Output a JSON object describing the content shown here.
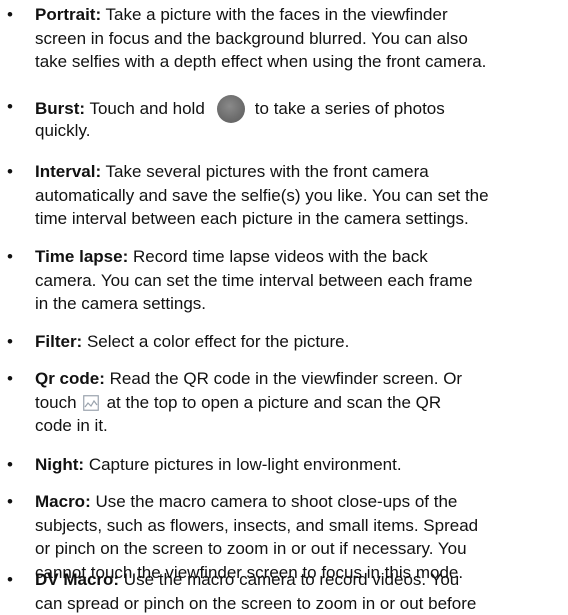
{
  "items": [
    {
      "term": "Portrait:",
      "lines": [
        " Take a picture with the faces in the viewfinder",
        "screen in focus and the background blurred. You can also",
        "take selfies with a depth effect when using the front camera."
      ]
    },
    {
      "term": "Burst:",
      "before_icon": " Touch and hold",
      "icon": "shutter-button-icon",
      "after_icon": "to take a series of photos",
      "lines": [
        "quickly."
      ]
    },
    {
      "term": "Interval:",
      "lines": [
        " Take several pictures with the front camera",
        "automatically and save the selfie(s) you like. You can set the",
        "time interval between each picture in the camera settings."
      ]
    },
    {
      "term": "Time lapse:",
      "lines": [
        " Record time lapse videos with the back",
        "camera. You can set the time interval between each frame",
        "in the camera settings."
      ]
    },
    {
      "term": "Filter:",
      "lines": [
        " Select a color effect for the picture."
      ]
    },
    {
      "term": "Qr code:",
      "lines": [
        " Read the QR code in the viewfinder screen. Or"
      ],
      "before_icon": "touch",
      "icon": "gallery-icon",
      "after_icon": "at the top to open a picture and scan the QR",
      "tail": "code in it."
    },
    {
      "term": "Night:",
      "lines": [
        " Capture pictures in low-light environment."
      ]
    },
    {
      "term": "Macro:",
      "lines": [
        " Use the macro camera to shoot close-ups of the",
        "subjects, such as flowers, insects, and small items. Spread",
        "or pinch on the screen to zoom in or out if necessary. You",
        "cannot touch the viewfinder screen to focus in this mode."
      ]
    },
    {
      "term": "DV Macro:",
      "lines": [
        " Use the macro camera to record videos. You",
        "can spread or pinch on the screen to zoom in or out before"
      ]
    }
  ]
}
